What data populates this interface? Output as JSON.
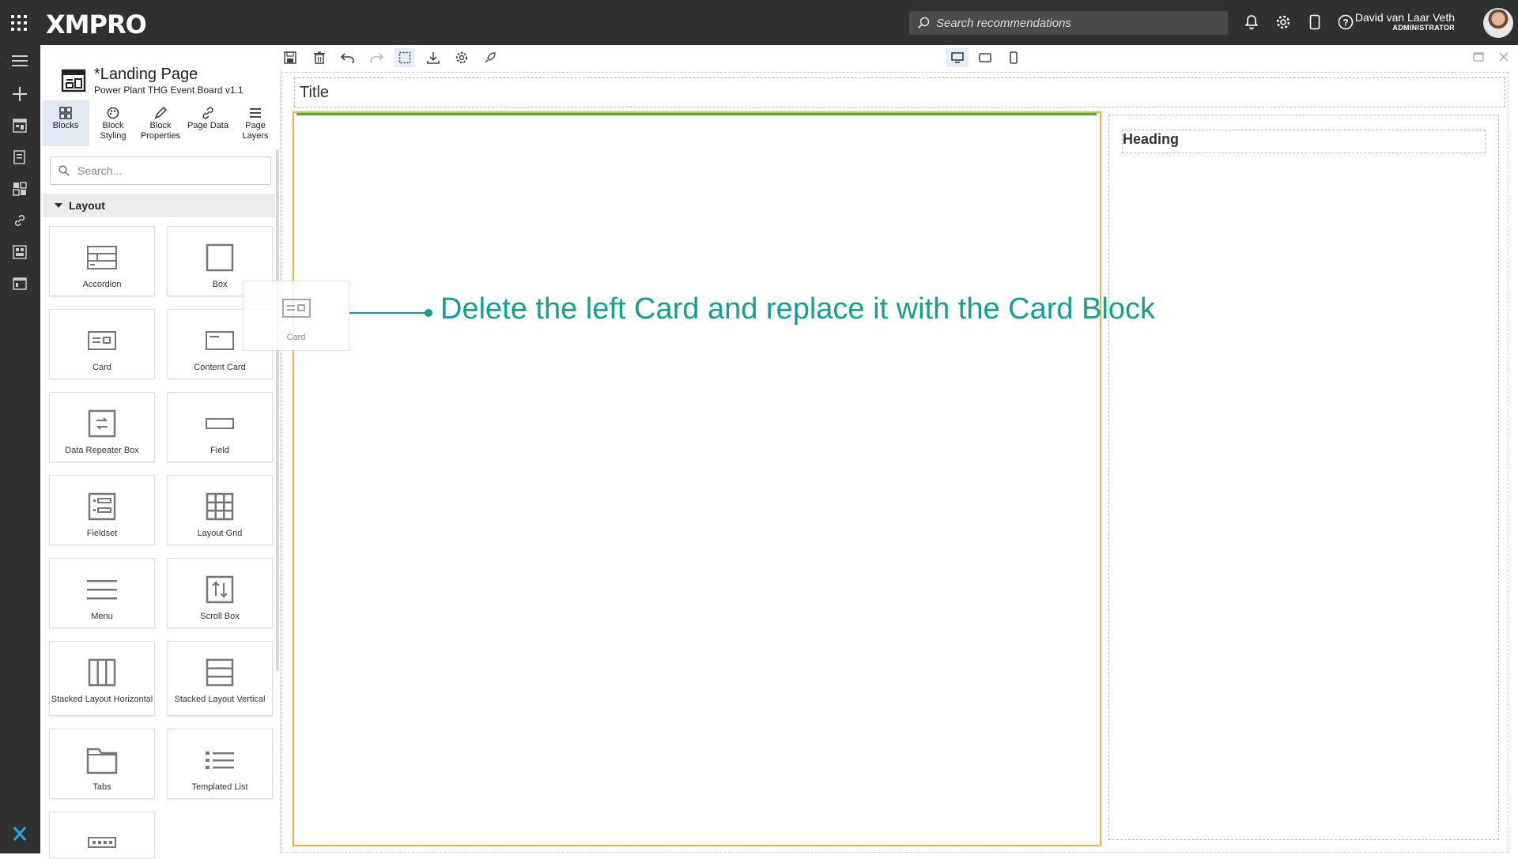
{
  "app": {
    "logo": "XMPRO"
  },
  "topbar": {
    "search_placeholder": "Search recommendations",
    "user_name": "David van Laar Veth",
    "user_role": "ADMINISTRATOR"
  },
  "page": {
    "title": "*Landing Page",
    "subtitle": "Power Plant THG Event Board v1.1"
  },
  "tabs": [
    {
      "label": "Blocks",
      "icon": "blocks-icon"
    },
    {
      "label": "Block Styling",
      "icon": "palette-icon"
    },
    {
      "label": "Block Properties",
      "icon": "pencil-icon"
    },
    {
      "label": "Page Data",
      "icon": "link-icon"
    },
    {
      "label": "Page Layers",
      "icon": "layers-icon"
    }
  ],
  "panel": {
    "search_placeholder": "Search...",
    "section": "Layout"
  },
  "blocks": [
    {
      "label": "Accordion",
      "icon": "accordion-icon"
    },
    {
      "label": "Box",
      "icon": "box-icon"
    },
    {
      "label": "Card",
      "icon": "card-icon"
    },
    {
      "label": "Content Card",
      "icon": "content-card-icon"
    },
    {
      "label": "Data Repeater Box",
      "icon": "repeater-icon"
    },
    {
      "label": "Field",
      "icon": "field-icon"
    },
    {
      "label": "Fieldset",
      "icon": "fieldset-icon"
    },
    {
      "label": "Layout Grid",
      "icon": "grid-icon"
    },
    {
      "label": "Menu",
      "icon": "menu-icon"
    },
    {
      "label": "Scroll Box",
      "icon": "scroll-box-icon"
    },
    {
      "label": "Stacked Layout Horizontal",
      "icon": "stack-horizontal-icon"
    },
    {
      "label": "Stacked Layout Vertical",
      "icon": "stack-vertical-icon"
    },
    {
      "label": "Tabs",
      "icon": "tabs-icon"
    },
    {
      "label": "Templated List",
      "icon": "list-icon"
    }
  ],
  "canvas": {
    "title": "Title",
    "heading": "Heading",
    "drag_ghost_label": "Card"
  },
  "annotation": {
    "text": "Delete the left Card and replace it with the Card Block",
    "color": "#13a08f"
  }
}
